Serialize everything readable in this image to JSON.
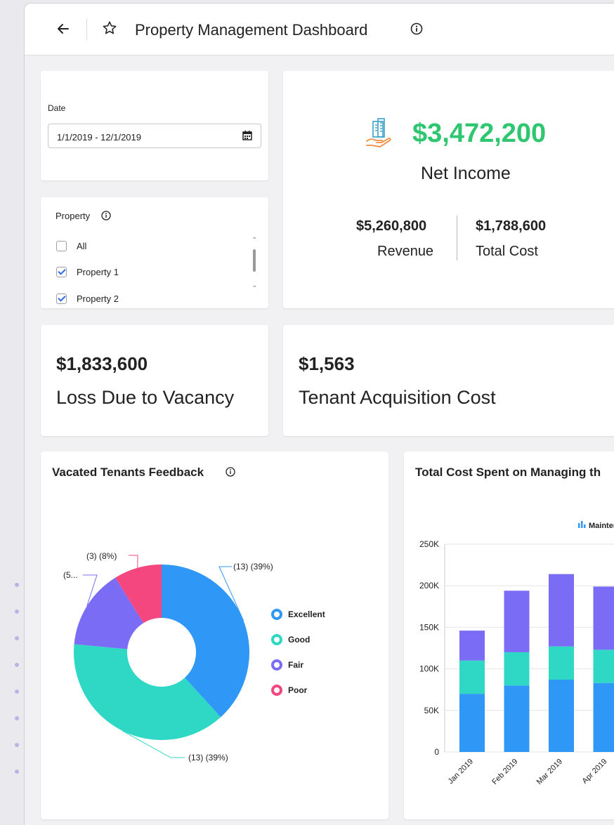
{
  "header": {
    "title": "Property Management Dashboard"
  },
  "date_filter": {
    "label": "Date",
    "value": "1/1/2019 - 12/1/2019"
  },
  "property_filter": {
    "label": "Property",
    "items": [
      {
        "label": "All",
        "checked": false
      },
      {
        "label": "Property 1",
        "checked": true
      },
      {
        "label": "Property 2",
        "checked": true
      }
    ]
  },
  "net_income": {
    "value": "$3,472,200",
    "label": "Net Income",
    "revenue_value": "$5,260,800",
    "revenue_label": "Revenue",
    "total_cost_value": "$1,788,600",
    "total_cost_label": "Total Cost"
  },
  "kpis": {
    "vacancy_value": "$1,833,600",
    "vacancy_label": "Loss Due to Vacancy",
    "acquisition_value": "$1,563",
    "acquisition_label": "Tenant Acquisition Cost"
  },
  "colors": {
    "accent_green": "#2ec66f",
    "excellent": "#2f97f6",
    "good": "#2fd8c4",
    "fair": "#7b6cf6",
    "poor": "#f4477f"
  },
  "feedback": {
    "title": "Vacated Tenants Feedback"
  },
  "cost_chart": {
    "title": "Total Cost Spent on Managing th",
    "legend_visible": "Maintenan"
  },
  "chart_data": [
    {
      "type": "pie",
      "title": "Vacated Tenants Feedback",
      "categories": [
        "Excellent",
        "Good",
        "Fair",
        "Poor"
      ],
      "values": [
        13,
        13,
        5,
        3
      ],
      "data_labels": [
        "(13) (39%)",
        "(13) (39%)",
        "(5...",
        "(3) (8%)"
      ],
      "legend_position": "right"
    },
    {
      "type": "bar",
      "stacked": true,
      "title": "Total Cost Spent on Managing th",
      "categories": [
        "Jan 2019",
        "Feb 2019",
        "Mar 2019",
        "Apr 2019"
      ],
      "series": [
        {
          "name": "Maintenan",
          "values": [
            70000,
            80000,
            87000,
            83000
          ]
        },
        {
          "values": [
            40000,
            40000,
            40000,
            40000
          ]
        },
        {
          "values": [
            36000,
            74000,
            87000,
            76000
          ]
        }
      ],
      "ylim": [
        0,
        250000
      ],
      "y_ticks": [
        "0",
        "50K",
        "100K",
        "150K",
        "200K",
        "250K"
      ],
      "grid": true
    }
  ]
}
